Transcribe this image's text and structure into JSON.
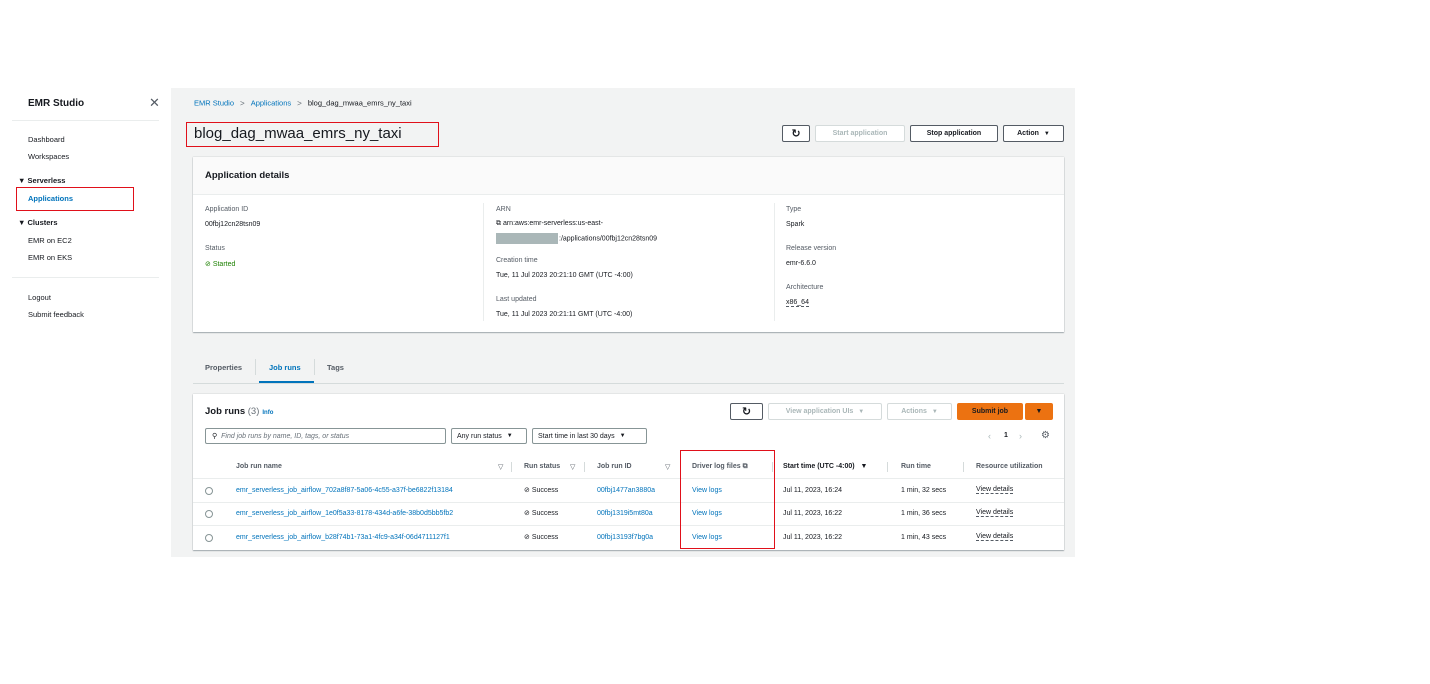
{
  "sidebar": {
    "title": "EMR Studio",
    "items": {
      "dashboard": "Dashboard",
      "workspaces": "Workspaces",
      "serverless": "Serverless",
      "applications": "Applications",
      "clusters": "Clusters",
      "emr_ec2": "EMR on EC2",
      "emr_eks": "EMR on EKS",
      "logout": "Logout",
      "feedback": "Submit feedback"
    }
  },
  "breadcrumb": [
    "EMR Studio",
    "Applications",
    "blog_dag_mwaa_emrs_ny_taxi"
  ],
  "page_title": "blog_dag_mwaa_emrs_ny_taxi",
  "header_buttons": {
    "start": "Start application",
    "stop": "Stop application",
    "action": "Action"
  },
  "details": {
    "title": "Application details",
    "app_id_label": "Application ID",
    "app_id": "00fbj12cn28tsn09",
    "status_label": "Status",
    "status": "Started",
    "arn_label": "ARN",
    "arn_line1": "arn:aws:emr-serverless:us-east-",
    "arn_line2": ":/applications/00fbj12cn28tsn09",
    "creation_label": "Creation time",
    "creation": "Tue, 11 Jul 2023 20:21:10 GMT (UTC -4:00)",
    "updated_label": "Last updated",
    "updated": "Tue, 11 Jul 2023 20:21:11 GMT (UTC -4:00)",
    "type_label": "Type",
    "type": "Spark",
    "release_label": "Release version",
    "release": "emr-6.6.0",
    "arch_label": "Architecture",
    "arch": "x86_64"
  },
  "tabs": [
    "Properties",
    "Job runs",
    "Tags"
  ],
  "jobs": {
    "title": "Job runs",
    "count": "(3)",
    "info": "Info",
    "view_uis": "View application UIs",
    "actions": "Actions",
    "submit": "Submit job",
    "search_placeholder": "Find job runs by name, ID, tags, or status",
    "status_filter": "Any run status",
    "time_filter": "Start time in last 30 days",
    "page": "1",
    "columns": {
      "name": "Job run name",
      "status": "Run status",
      "id": "Job run ID",
      "logs": "Driver log files",
      "start": "Start time (UTC -4:00)",
      "runtime": "Run time",
      "resource": "Resource utilization"
    },
    "rows": [
      {
        "name": "emr_serverless_job_airflow_702a8f87-5a06-4c55-a37f-be6822f13184",
        "status": "Success",
        "id": "00fbj1477an3880a",
        "logs": "View logs",
        "start": "Jul 11, 2023, 16:24",
        "runtime": "1 min, 32 secs",
        "resource": "View details"
      },
      {
        "name": "emr_serverless_job_airflow_1e0f5a33-8178-434d-a6fe-38b0d5bb5fb2",
        "status": "Success",
        "id": "00fbj1319i5mt80a",
        "logs": "View logs",
        "start": "Jul 11, 2023, 16:22",
        "runtime": "1 min, 36 secs",
        "resource": "View details"
      },
      {
        "name": "emr_serverless_job_airflow_b28f74b1-73a1-4fc9-a34f-06d4711127f1",
        "status": "Success",
        "id": "00fbj13193f7bg0a",
        "logs": "View logs",
        "start": "Jul 11, 2023, 16:22",
        "runtime": "1 min, 43 secs",
        "resource": "View details"
      }
    ]
  },
  "colors": {
    "accent": "#0073bb",
    "primary": "#ec7211",
    "success": "#1d8102",
    "highlight": "#e0101a"
  }
}
